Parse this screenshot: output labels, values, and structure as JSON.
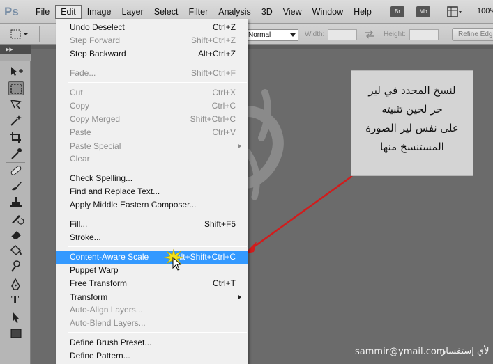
{
  "app": {
    "logo": "Ps",
    "menus": [
      "File",
      "Edit",
      "Image",
      "Layer",
      "Select",
      "Filter",
      "Analysis",
      "3D",
      "View",
      "Window",
      "Help"
    ],
    "active_menu": "Edit",
    "bridge_labels": [
      "Br",
      "Mb"
    ],
    "zoom": "100%"
  },
  "options": {
    "style_value": "Normal",
    "width_label": "Width:",
    "height_label": "Height:",
    "refine_label": "Refine Edge..."
  },
  "edit_menu": {
    "items": [
      {
        "label": "Undo Deselect",
        "shortcut": "Ctrl+Z",
        "enabled": true
      },
      {
        "label": "Step Forward",
        "shortcut": "Shift+Ctrl+Z",
        "enabled": false
      },
      {
        "label": "Step Backward",
        "shortcut": "Alt+Ctrl+Z",
        "enabled": true
      },
      {
        "label": "Fade...",
        "shortcut": "Shift+Ctrl+F",
        "enabled": false
      },
      {
        "label": "Cut",
        "shortcut": "Ctrl+X",
        "enabled": false
      },
      {
        "label": "Copy",
        "shortcut": "Ctrl+C",
        "enabled": false
      },
      {
        "label": "Copy Merged",
        "shortcut": "Shift+Ctrl+C",
        "enabled": false
      },
      {
        "label": "Paste",
        "shortcut": "Ctrl+V",
        "enabled": false
      },
      {
        "label": "Paste Special",
        "shortcut": "",
        "enabled": false,
        "submenu": true
      },
      {
        "label": "Clear",
        "shortcut": "",
        "enabled": false
      },
      {
        "label": "Check Spelling...",
        "shortcut": "",
        "enabled": true
      },
      {
        "label": "Find and Replace Text...",
        "shortcut": "",
        "enabled": true
      },
      {
        "label": "Apply Middle Eastern Composer...",
        "shortcut": "",
        "enabled": true
      },
      {
        "label": "Fill...",
        "shortcut": "Shift+F5",
        "enabled": true
      },
      {
        "label": "Stroke...",
        "shortcut": "",
        "enabled": true
      },
      {
        "label": "Content-Aware Scale",
        "shortcut": "Alt+Shift+Ctrl+C",
        "enabled": true,
        "highlighted": true
      },
      {
        "label": "Puppet Warp",
        "shortcut": "",
        "enabled": true
      },
      {
        "label": "Free Transform",
        "shortcut": "Ctrl+T",
        "enabled": true
      },
      {
        "label": "Transform",
        "shortcut": "",
        "enabled": true,
        "submenu": true
      },
      {
        "label": "Auto-Align Layers...",
        "shortcut": "",
        "enabled": false
      },
      {
        "label": "Auto-Blend Layers...",
        "shortcut": "",
        "enabled": false
      },
      {
        "label": "Define Brush Preset...",
        "shortcut": "",
        "enabled": true
      },
      {
        "label": "Define Pattern...",
        "shortcut": "",
        "enabled": true
      }
    ]
  },
  "note": {
    "lines": [
      "لنسخ المحدد في لير",
      "حر لحين تثبيته",
      "على نفس لير الصورة",
      "المستنسخ منها"
    ]
  },
  "footer": {
    "email": "sammir@ymail.com",
    "inquiry": "لأي إستفسار"
  },
  "colors": {
    "highlight": "#3399ff",
    "arrow": "#d11c1c",
    "canvas": "#6b6b6b"
  }
}
